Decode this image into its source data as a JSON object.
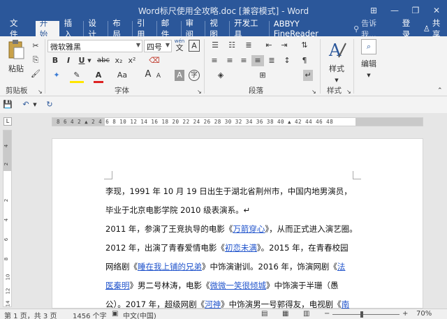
{
  "window": {
    "title": "Word标尺使用全攻略.doc [兼容模式] - Word",
    "controls": [
      "⊞",
      "—",
      "❐",
      "✕"
    ]
  },
  "tabs": [
    "文件",
    "开始",
    "插入",
    "设计",
    "布局",
    "引用",
    "邮件",
    "审阅",
    "视图",
    "开发工具",
    "ABBYY FineReader"
  ],
  "tell_me": "告诉我...",
  "login": "登录",
  "share": "共享",
  "ribbon": {
    "clipboard_paste": "粘贴",
    "clipboard_label": "剪贴板",
    "font_name": "微软雅黑",
    "font_size": "四号",
    "font_label": "字体",
    "paragraph_label": "段落",
    "styles_button": "样式",
    "styles_label": "样式",
    "edit_button": "编辑",
    "wen_top": "wén",
    "wen_char": "文",
    "A_box": "A",
    "bold": "B",
    "italic": "I",
    "underline": "U",
    "strike": "abc",
    "sub": "x₂",
    "sup": "x²",
    "font_color": "A",
    "aa": "Aa",
    "grow": "A",
    "shrink": "A",
    "char_shade": "A",
    "enclose": "字"
  },
  "ruler": {
    "h_numbers": "8  6  4  2  ▲  2  4  6  8  10 12 14 16 18 20 22 24 26 28 30 32 34 36 38 40  ▲   42 44 46 48",
    "v_numbers": [
      "4",
      "2",
      "2",
      "4",
      "6",
      "8",
      "10",
      "12",
      "14"
    ]
  },
  "document": {
    "lines": [
      [
        {
          "t": "李现，1991 年 10 月 19 日出生于湖北省荆州市，中国内地男演员，"
        }
      ],
      [
        {
          "t": "毕业于北京电影学院 2010 级表演系。↵"
        }
      ],
      [
        {
          "t": "2011 年，参演了王竞执导的电影《"
        },
        {
          "t": "万箭穿心",
          "link": true
        },
        {
          "t": "》，从而正式进入演艺圈。"
        }
      ],
      [
        {
          "t": "2012 年，出演了青春爱情电影《"
        },
        {
          "t": "初恋未满",
          "link": true
        },
        {
          "t": "》。2015 年，在青春校园"
        }
      ],
      [
        {
          "t": "网络剧《"
        },
        {
          "t": "睡在我上铺的兄弟",
          "link": true
        },
        {
          "t": "》中饰演谢训。2016 年，饰演网剧《"
        },
        {
          "t": "法",
          "link": true
        }
      ],
      [
        {
          "t": "医秦明",
          "link": true
        },
        {
          "t": "》男二号林涛，电影《"
        },
        {
          "t": "微微一笑很倾城",
          "link": true
        },
        {
          "t": "》中饰演于半珊（愚"
        }
      ],
      [
        {
          "t": "公）。2017 年，超级网剧《"
        },
        {
          "t": "河神",
          "link": true
        },
        {
          "t": "》中饰演男一号郭得友，电视剧《"
        },
        {
          "t": "南",
          "link": true
        }
      ]
    ]
  },
  "status": {
    "page": "第 1 页，共 3 页",
    "words": "1456 个字",
    "lang": "中文(中国)",
    "zoom": "70%",
    "zoom_fraction": 0.7
  }
}
